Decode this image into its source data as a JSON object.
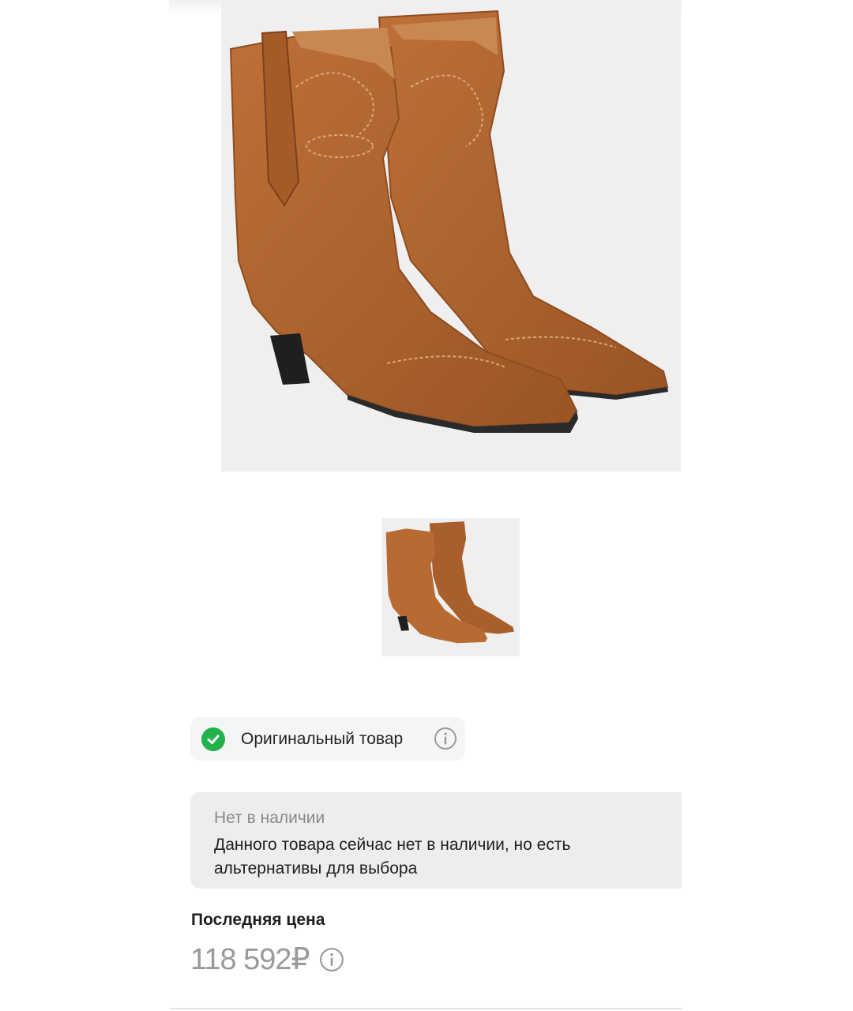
{
  "product": {
    "main_image_icon": "boots-photo",
    "thumbnail_icon": "boots-photo-thumbnail"
  },
  "authenticity": {
    "label": "Оригинальный товар",
    "check_icon": "check-circle-icon",
    "info_icon": "info-icon",
    "color": "#22b24c"
  },
  "availability": {
    "title": "Нет в наличии",
    "text": "Данного товара сейчас нет в наличии, но есть альтернативы для выбора"
  },
  "price": {
    "label": "Последняя цена",
    "value": "118 592₽",
    "info_icon": "info-icon"
  },
  "colors": {
    "suede": "#b06530",
    "suede_dark": "#8e4c20",
    "image_bg": "#efefef"
  }
}
